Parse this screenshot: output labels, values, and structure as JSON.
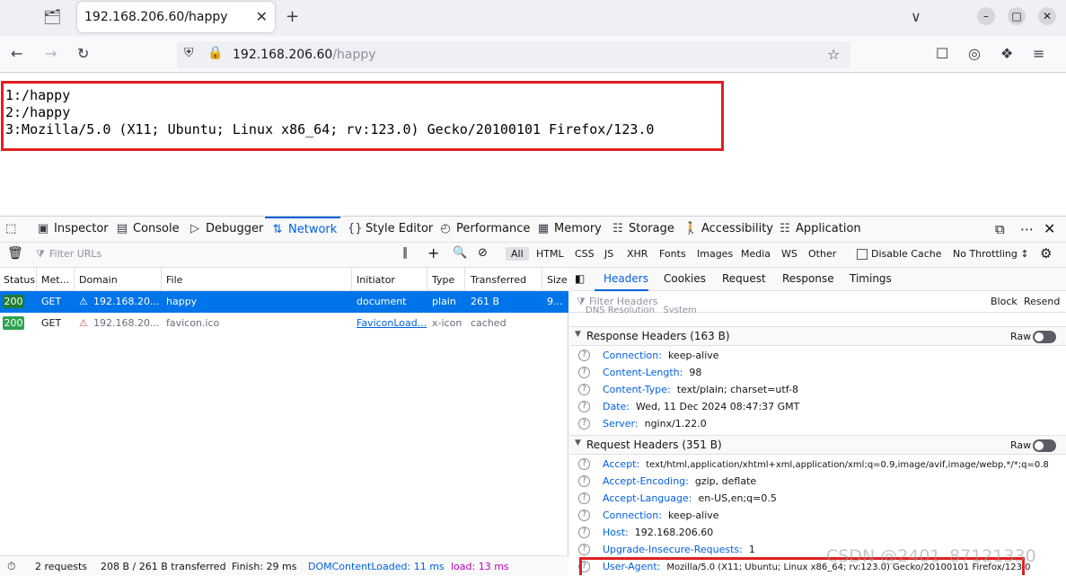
{
  "browser": {
    "tab_title": "192.168.206.60/happy",
    "url_host": "192.168.206.60",
    "url_path": "/happy"
  },
  "page": {
    "lines": [
      "1:/happy",
      "2:/happy",
      "3:Mozilla/5.0 (X11; Ubuntu; Linux x86_64; rv:123.0) Gecko/20100101 Firefox/123.0"
    ]
  },
  "devtools": {
    "tabs": [
      "Inspector",
      "Console",
      "Debugger",
      "Network",
      "Style Editor",
      "Performance",
      "Memory",
      "Storage",
      "Accessibility",
      "Application"
    ],
    "active_tab": "Network",
    "filter_placeholder": "Filter URLs",
    "type_filters": [
      "All",
      "HTML",
      "CSS",
      "JS",
      "XHR",
      "Fonts",
      "Images",
      "Media",
      "WS",
      "Other"
    ],
    "disable_cache_label": "Disable Cache",
    "throttling": "No Throttling ↕",
    "columns": [
      "Status",
      "Met...",
      "Domain",
      "File",
      "Initiator",
      "Type",
      "Transferred",
      "Size"
    ],
    "requests": [
      {
        "status": "200",
        "method": "GET",
        "domain": "192.168.20...",
        "file": "happy",
        "initiator": "document",
        "type": "plain",
        "transferred": "261 B",
        "size": "9..."
      },
      {
        "status": "200",
        "method": "GET",
        "domain": "192.168.20...",
        "file": "favicon.ico",
        "initiator": "FaviconLoad...",
        "type": "x-icon",
        "transferred": "cached",
        "size": ""
      }
    ],
    "panel_tabs": [
      "Headers",
      "Cookies",
      "Request",
      "Response",
      "Timings"
    ],
    "header_filter_placeholder": "Filter Headers",
    "block_label": "Block",
    "resend_label": "Resend",
    "truncated_row": "DNS Resolution   System",
    "response_headers": {
      "title": "Response Headers (163 B)",
      "raw_label": "Raw",
      "items": [
        {
          "key": "Connection:",
          "value": "keep-alive"
        },
        {
          "key": "Content-Length:",
          "value": "98"
        },
        {
          "key": "Content-Type:",
          "value": "text/plain; charset=utf-8"
        },
        {
          "key": "Date:",
          "value": "Wed, 11 Dec 2024 08:47:37 GMT"
        },
        {
          "key": "Server:",
          "value": "nginx/1.22.0"
        }
      ]
    },
    "request_headers": {
      "title": "Request Headers (351 B)",
      "raw_label": "Raw",
      "items": [
        {
          "key": "Accept:",
          "value": "text/html,application/xhtml+xml,application/xml;q=0.9,image/avif,image/webp,*/*;q=0.8"
        },
        {
          "key": "Accept-Encoding:",
          "value": "gzip, deflate"
        },
        {
          "key": "Accept-Language:",
          "value": "en-US,en;q=0.5"
        },
        {
          "key": "Connection:",
          "value": "keep-alive"
        },
        {
          "key": "Host:",
          "value": "192.168.206.60"
        },
        {
          "key": "Upgrade-Insecure-Requests:",
          "value": "1"
        },
        {
          "key": "User-Agent:",
          "value": "Mozilla/5.0 (X11; Ubuntu; Linux x86_64; rv:123.0) Gecko/20100101 Firefox/123.0"
        }
      ]
    },
    "statusbar": {
      "requests": "2 requests",
      "transferred": "208 B / 261 B transferred",
      "finish": "Finish: 29 ms",
      "domcontentloaded": "DOMContentLoaded: 11 ms",
      "load": "load: 13 ms"
    }
  },
  "watermark": "CSDN @2401_87121330"
}
